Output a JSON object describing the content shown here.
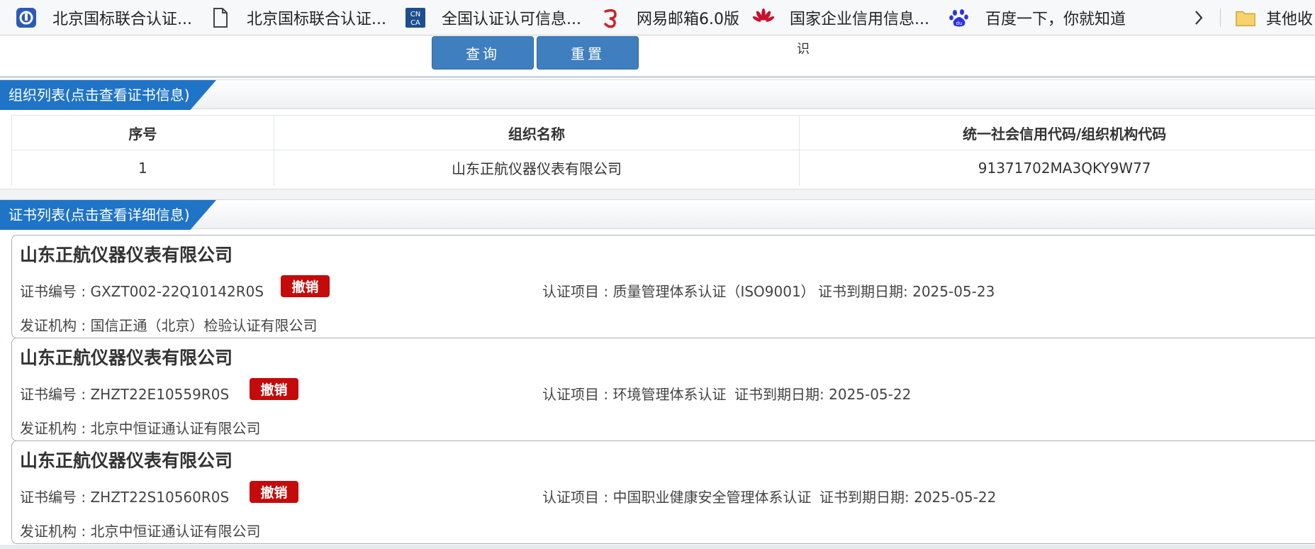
{
  "bookmarks": {
    "items": [
      {
        "label": "北京国标联合认证...",
        "icon": "gbld-logo-icon"
      },
      {
        "label": "北京国标联合认证...",
        "icon": "document-icon"
      },
      {
        "label": "全国认证认可信息...",
        "icon": "cnca-logo-icon"
      },
      {
        "label": "网易邮箱6.0版",
        "icon": "netease-mail-icon"
      },
      {
        "label": "国家企业信用信息...",
        "icon": "huawei-style-logo-icon"
      },
      {
        "label": "百度一下，你就知道",
        "icon": "baidu-paw-icon"
      }
    ],
    "other": {
      "label": "其他收",
      "icon": "folder-icon"
    }
  },
  "query": {
    "query_label": "查询",
    "reset_label": "重置",
    "stray_text": "识"
  },
  "org_section": {
    "title": "组织列表(点击查看证书信息)",
    "columns": [
      "序号",
      "组织名称",
      "统一社会信用代码/组织机构代码"
    ],
    "rows": [
      {
        "index": "1",
        "name": "山东正航仪器仪表有限公司",
        "code": "91371702MA3QKY9W77"
      }
    ]
  },
  "cert_section": {
    "title": "证书列表(点击查看详细信息)",
    "certs": [
      {
        "company": "山东正航仪器仪表有限公司",
        "cert_no": "证书编号 : GXZT002-22Q10142R0S",
        "status": "撤销",
        "project": "认证项目 : 质量管理体系认证（ISO9001）",
        "expiry": "证书到期日期: 2025-05-23",
        "issuer": "发证机构 : 国信正通（北京）检验认证有限公司"
      },
      {
        "company": "山东正航仪器仪表有限公司",
        "cert_no": "证书编号 : ZHZT22E10559R0S",
        "status": "撤销",
        "project": "认证项目 : 环境管理体系认证",
        "expiry": "证书到期日期: 2025-05-22",
        "issuer": "发证机构 : 北京中恒证通认证有限公司"
      },
      {
        "company": "山东正航仪器仪表有限公司",
        "cert_no": "证书编号 : ZHZT22S10560R0S",
        "status": "撤销",
        "project": "认证项目 : 中国职业健康安全管理体系认证",
        "expiry": "证书到期日期: 2025-05-22",
        "issuer": "发证机构 : 北京中恒证通认证有限公司"
      }
    ]
  },
  "colors": {
    "primary_button": "#3f7fbf",
    "section_tab": "#1f74c7",
    "revoked_badge": "#c40a0a"
  }
}
